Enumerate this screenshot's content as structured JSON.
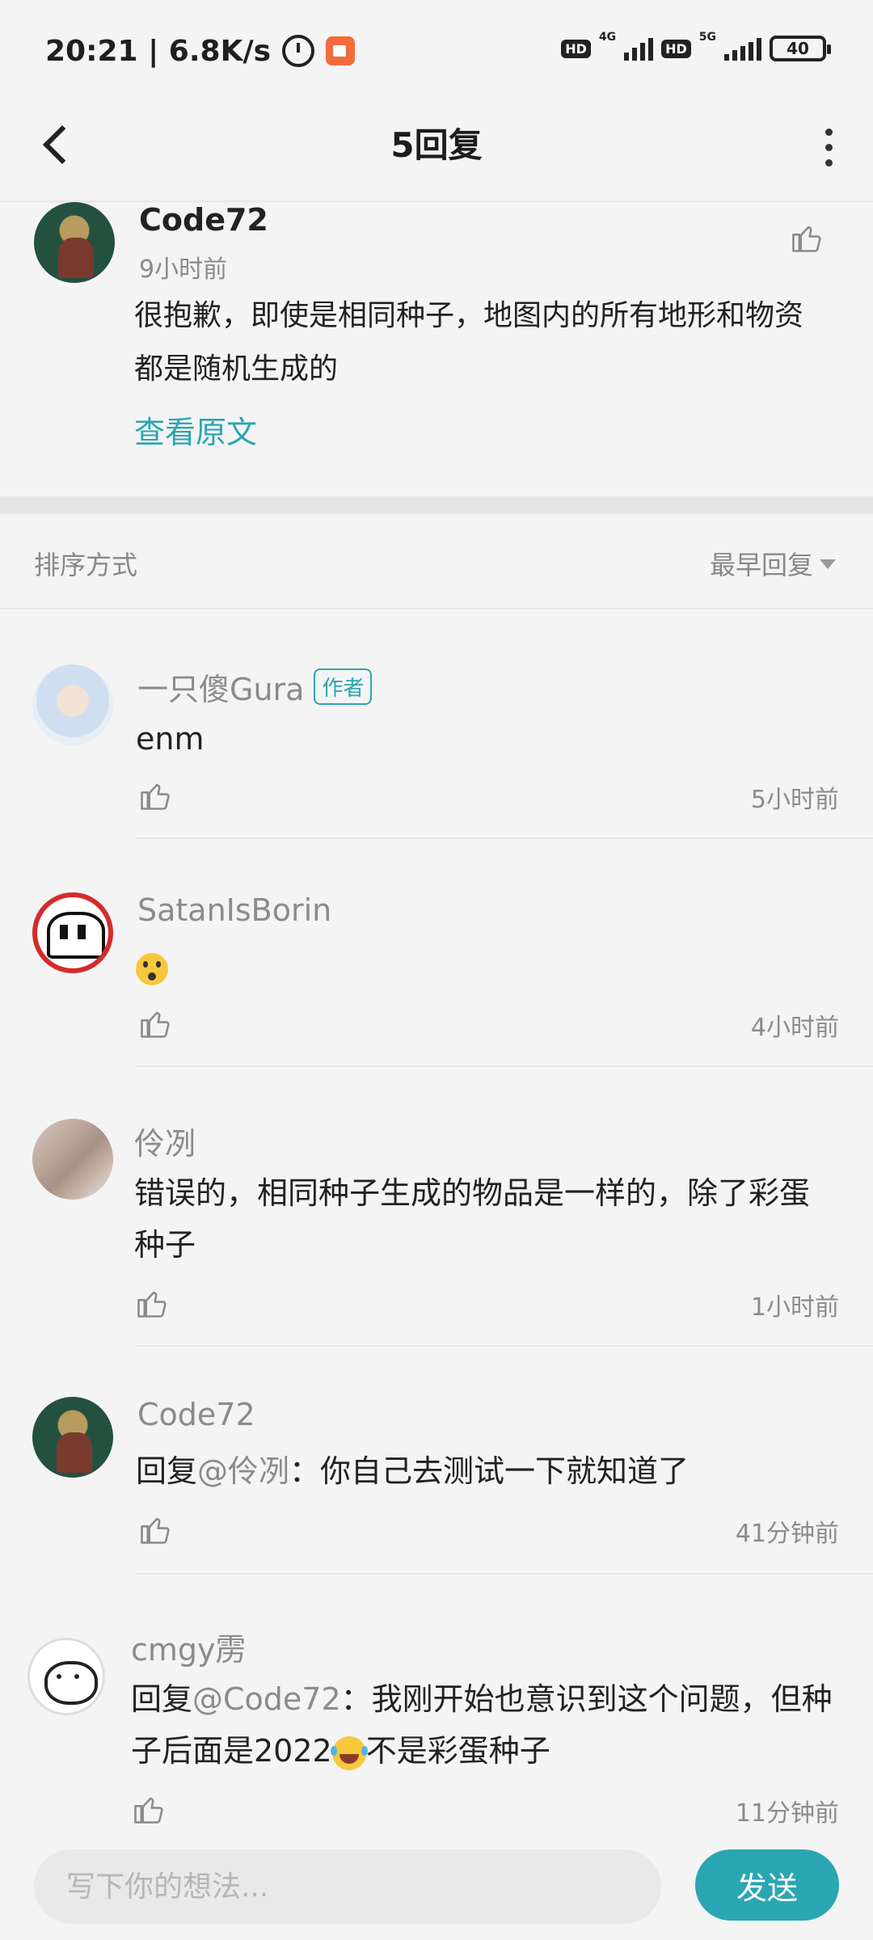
{
  "status_bar": {
    "time": "20:21 | 6.8K/s",
    "hd1": "HD",
    "net1": "4G",
    "hd2": "HD",
    "net2": "5G",
    "battery": "40"
  },
  "header": {
    "title": "5回复"
  },
  "main_comment": {
    "author": "Code72",
    "time": "9小时前",
    "text": "很抱歉，即使是相同种子，地图内的所有地形和物资都是随机生成的",
    "view_original": "查看原文"
  },
  "sort": {
    "label": "排序方式",
    "value": "最早回复"
  },
  "replies": [
    {
      "author": "一只傻Gura",
      "badge": "作者",
      "text": "enm",
      "time": "5小时前"
    },
    {
      "author": "SatanIsBorin",
      "text": "",
      "time": "4小时前"
    },
    {
      "author": "伶冽",
      "text": "错误的，相同种子生成的物品是一样的，除了彩蛋种子",
      "time": "1小时前"
    },
    {
      "author": "Code72",
      "prefix": "回复",
      "mention": "@伶冽",
      "text": "：你自己去测试一下就知道了",
      "time": "41分钟前"
    },
    {
      "author": "cmgy雳",
      "prefix": "回复",
      "mention": "@Code72",
      "text_a": "：我刚开始也意识到这个问题，但种子后面是2022",
      "text_b": "不是彩蛋种子",
      "time": "11分钟前"
    }
  ],
  "composer": {
    "placeholder": "写下你的想法...",
    "send_label": "发送"
  },
  "colors": {
    "accent": "#2aa6b2",
    "background": "#f4f4f4"
  }
}
